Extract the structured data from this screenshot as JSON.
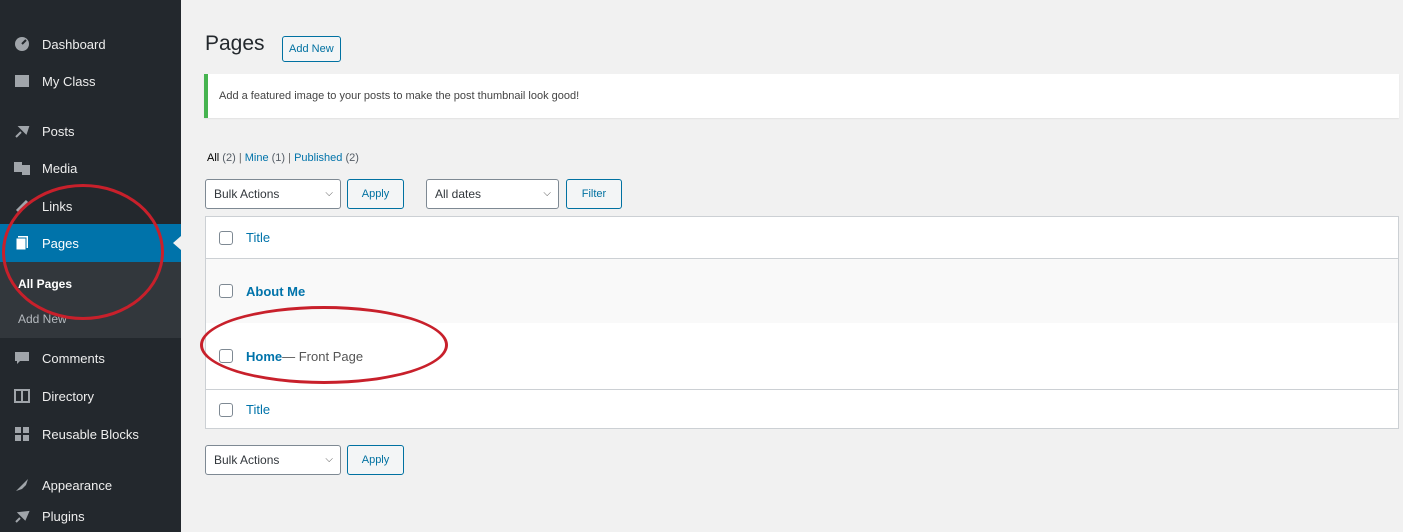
{
  "sidebar": {
    "items": [
      {
        "label": "Dashboard",
        "icon": "dashboard-icon"
      },
      {
        "label": "My Class",
        "icon": "class-icon"
      },
      {
        "label": "Posts",
        "icon": "pin-icon"
      },
      {
        "label": "Media",
        "icon": "media-icon"
      },
      {
        "label": "Links",
        "icon": "link-icon"
      },
      {
        "label": "Pages",
        "icon": "pages-icon"
      },
      {
        "label": "Comments",
        "icon": "comment-icon"
      },
      {
        "label": "Directory",
        "icon": "directory-icon"
      },
      {
        "label": "Reusable Blocks",
        "icon": "blocks-icon"
      },
      {
        "label": "Appearance",
        "icon": "appearance-icon"
      },
      {
        "label": "Plugins",
        "icon": "plugins-icon"
      }
    ],
    "submenu": {
      "all_pages": "All Pages",
      "add_new": "Add New"
    }
  },
  "header": {
    "title": "Pages",
    "add_new": "Add New"
  },
  "notice": {
    "text": "Add a featured image to your posts to make the post thumbnail look good!"
  },
  "filters": {
    "all": "All",
    "all_count": "(2)",
    "mine": "Mine",
    "mine_count": "(1)",
    "published": "Published",
    "published_count": "(2)",
    "separator": "|"
  },
  "toolbar": {
    "bulk_actions": "Bulk Actions",
    "apply": "Apply",
    "all_dates": "All dates",
    "filter": "Filter"
  },
  "table": {
    "header_title": "Title",
    "footer_title": "Title",
    "rows": [
      {
        "title": "About Me",
        "state": ""
      },
      {
        "title": "Home",
        "state": " — Front Page"
      }
    ]
  },
  "colors": {
    "sidebar_bg": "#23282d",
    "active_bg": "#0073aa",
    "link": "#0073aa",
    "notice_border": "#46b450",
    "annotation": "#c8202b"
  }
}
